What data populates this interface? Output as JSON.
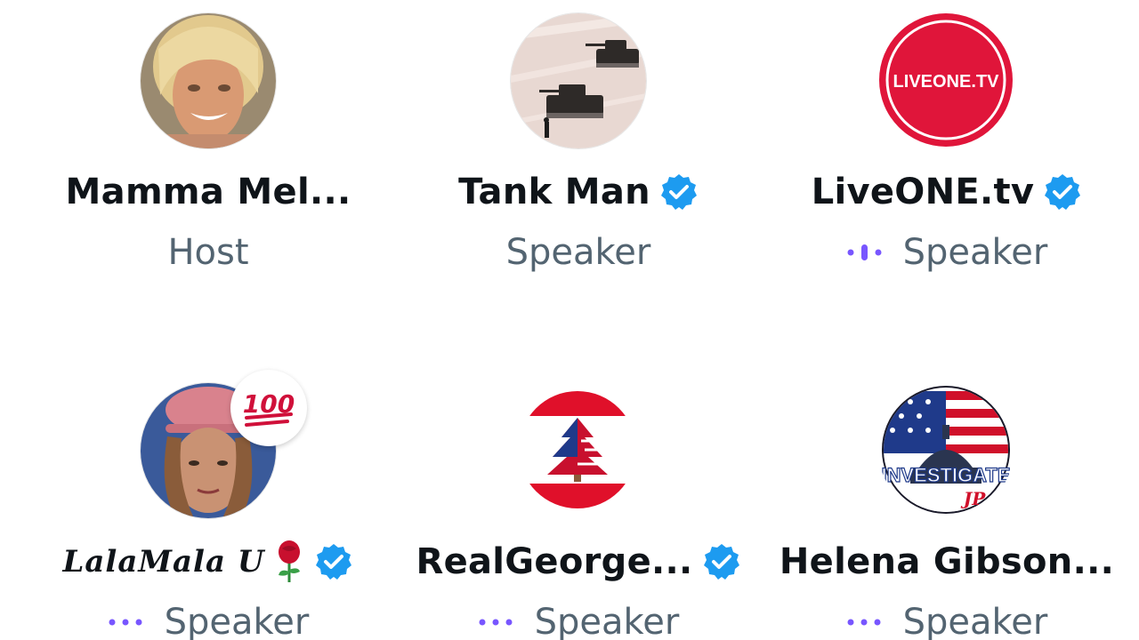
{
  "participants": [
    {
      "name": "Mamma Mel...",
      "role": "Host",
      "verified": false,
      "speaking_indicator": "none",
      "avatar": "photo-blonde-woman"
    },
    {
      "name": "Tank Man",
      "role": "Speaker",
      "verified": true,
      "speaking_indicator": "none",
      "avatar": "tank-man-photo"
    },
    {
      "name": "LiveONE.tv",
      "role": "Speaker",
      "verified": true,
      "speaking_indicator": "speaking",
      "avatar": "liveone-logo",
      "avatar_text": "LIVEONE.TV"
    },
    {
      "name": "LalaMala U",
      "role": "Speaker",
      "verified": true,
      "speaking_indicator": "idle",
      "avatar": "photo-woman-pink-hat",
      "reaction": "💯",
      "emoji": "rose"
    },
    {
      "name": "RealGeorge...",
      "role": "Speaker",
      "verified": true,
      "speaking_indicator": "idle",
      "avatar": "lebanon-flag-cedar"
    },
    {
      "name": "Helena Gibson...",
      "role": "Speaker",
      "verified": false,
      "speaking_indicator": "idle",
      "avatar": "investigate-logo",
      "avatar_text": "INVESTIGATE"
    }
  ],
  "colors": {
    "verified": "#1d9bf0",
    "role_text": "#536471",
    "name_text": "#0f1419",
    "indicator": "#7856ff",
    "liveone_red": "#e0153a"
  }
}
